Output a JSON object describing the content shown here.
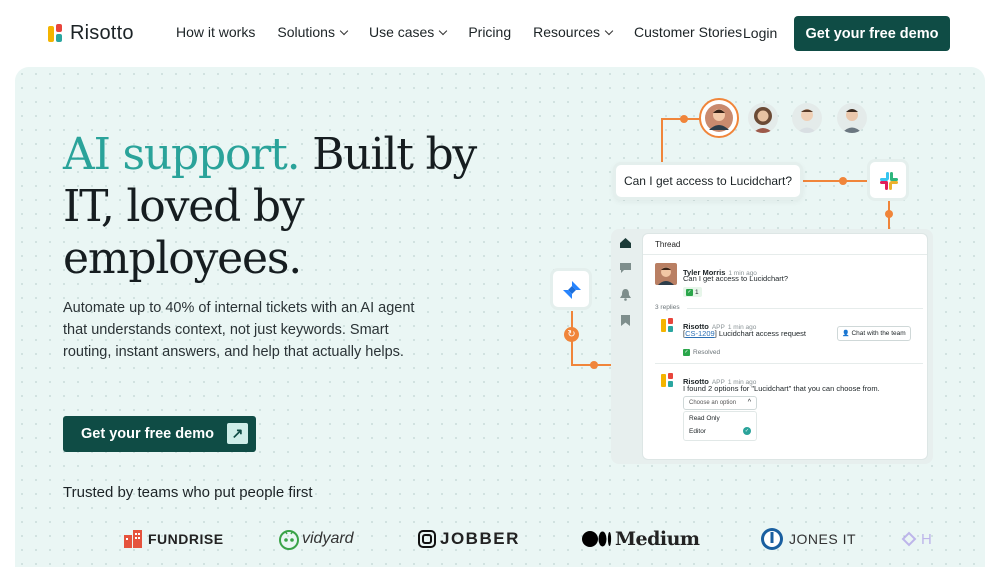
{
  "brand": {
    "name": "Risotto"
  },
  "nav": {
    "links": [
      {
        "label": "How it works",
        "dropdown": false
      },
      {
        "label": "Solutions",
        "dropdown": true
      },
      {
        "label": "Use cases",
        "dropdown": true
      },
      {
        "label": "Pricing",
        "dropdown": false
      },
      {
        "label": "Resources",
        "dropdown": true
      },
      {
        "label": "Customer Stories",
        "dropdown": false
      }
    ],
    "login": "Login",
    "cta": "Get your free demo"
  },
  "hero": {
    "headline_accent": "AI support.",
    "headline_rest": " Built by IT, loved by employees.",
    "subtext": "Automate up to 40% of internal tickets with an AI agent that understands context, not just keywords. Smart routing, instant answers, and help that actually helps.",
    "cta": "Get your free demo",
    "trusted": "Trusted by teams who put people first"
  },
  "logos": [
    "FUNDRISE",
    "vidyard",
    "JOBBER",
    "Medium",
    "JONES IT",
    "H"
  ],
  "illustration": {
    "question_bubble": "Can I get access to Lucidchart?",
    "thread": {
      "title": "Thread",
      "msg1": {
        "name": "Tyler Morris",
        "time": "1 min ago",
        "text": "Can I get access to Lucidchart?",
        "reaction": "1"
      },
      "replies": "3 replies",
      "msg2": {
        "name": "Risotto",
        "badge": "APP",
        "time": "1 min ago",
        "ticket": "CS-1209",
        "text": " Lucidchart access request",
        "button": "Chat with the team",
        "status": "Resolved"
      },
      "msg3": {
        "name": "Risotto",
        "badge": "APP",
        "time": "1 min ago",
        "text": "I found 2 options for \"Lucidchart\" that you can choose from.",
        "select_placeholder": "Choose an option",
        "options": [
          "Read Only",
          "Editor"
        ]
      }
    }
  },
  "colors": {
    "primary": "#0f4c45",
    "accent": "#2aa39a",
    "connector": "#f0853a",
    "hero_bg": "#eaf6f4"
  }
}
